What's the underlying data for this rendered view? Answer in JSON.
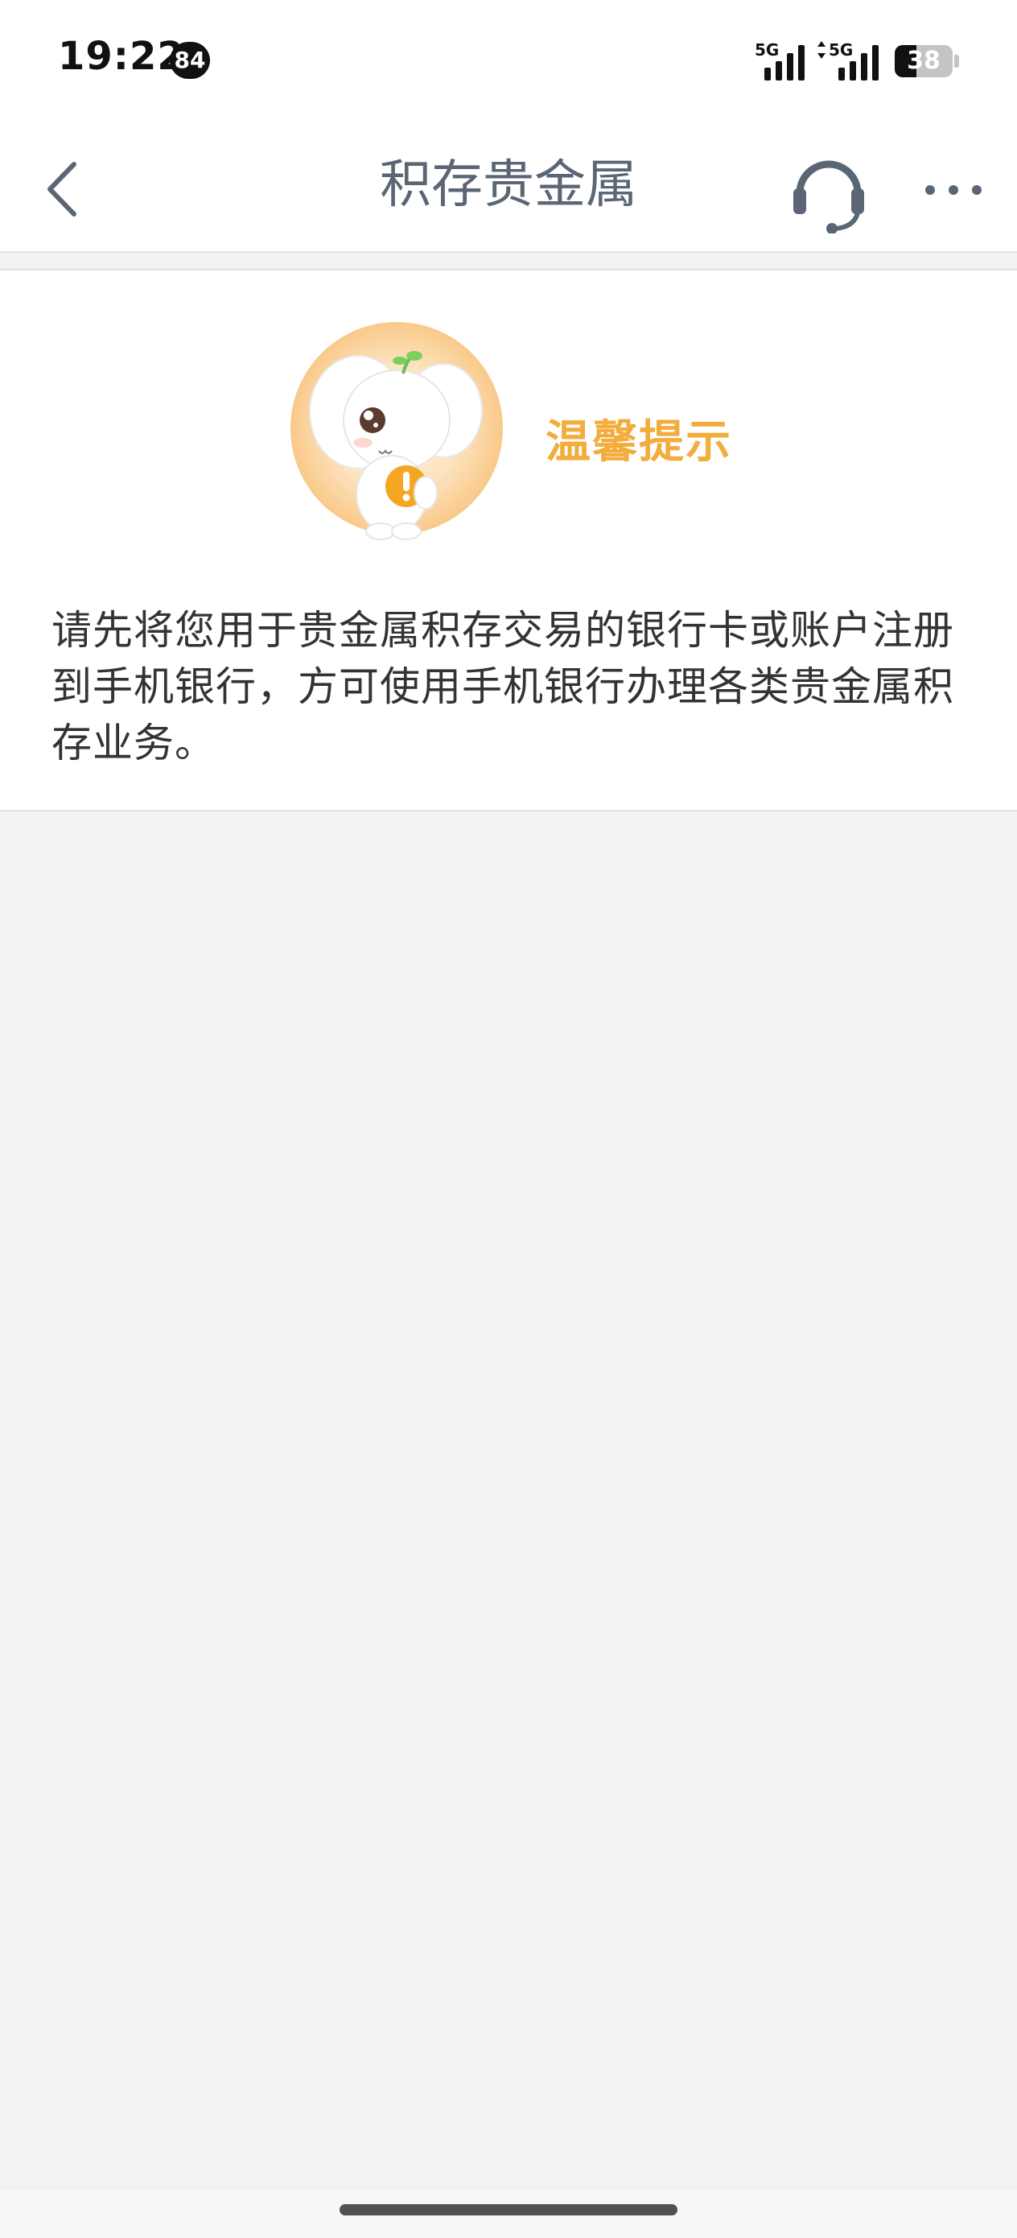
{
  "status_bar": {
    "time": "19:22",
    "notification_count": "84",
    "signal_1_label": "5G",
    "signal_2_label": "5G",
    "battery_level": "38",
    "battery_fraction": 0.38
  },
  "nav": {
    "title": "积存贵金属",
    "back_icon": "chevron-left-icon",
    "support_icon": "headset-icon",
    "more_icon": "more-dots-icon"
  },
  "notice": {
    "title": "温馨提示",
    "message": "请先将您用于贵金属积存交易的银行卡或账户注册到手机银行，方可使用手机银行办理各类贵金属积存业务。",
    "mascot_icon": "elephant-mascot-warning-icon"
  },
  "colors": {
    "accent": "#f2ad3c",
    "title_gray": "#5b6675",
    "background": "#f2f2f2"
  }
}
